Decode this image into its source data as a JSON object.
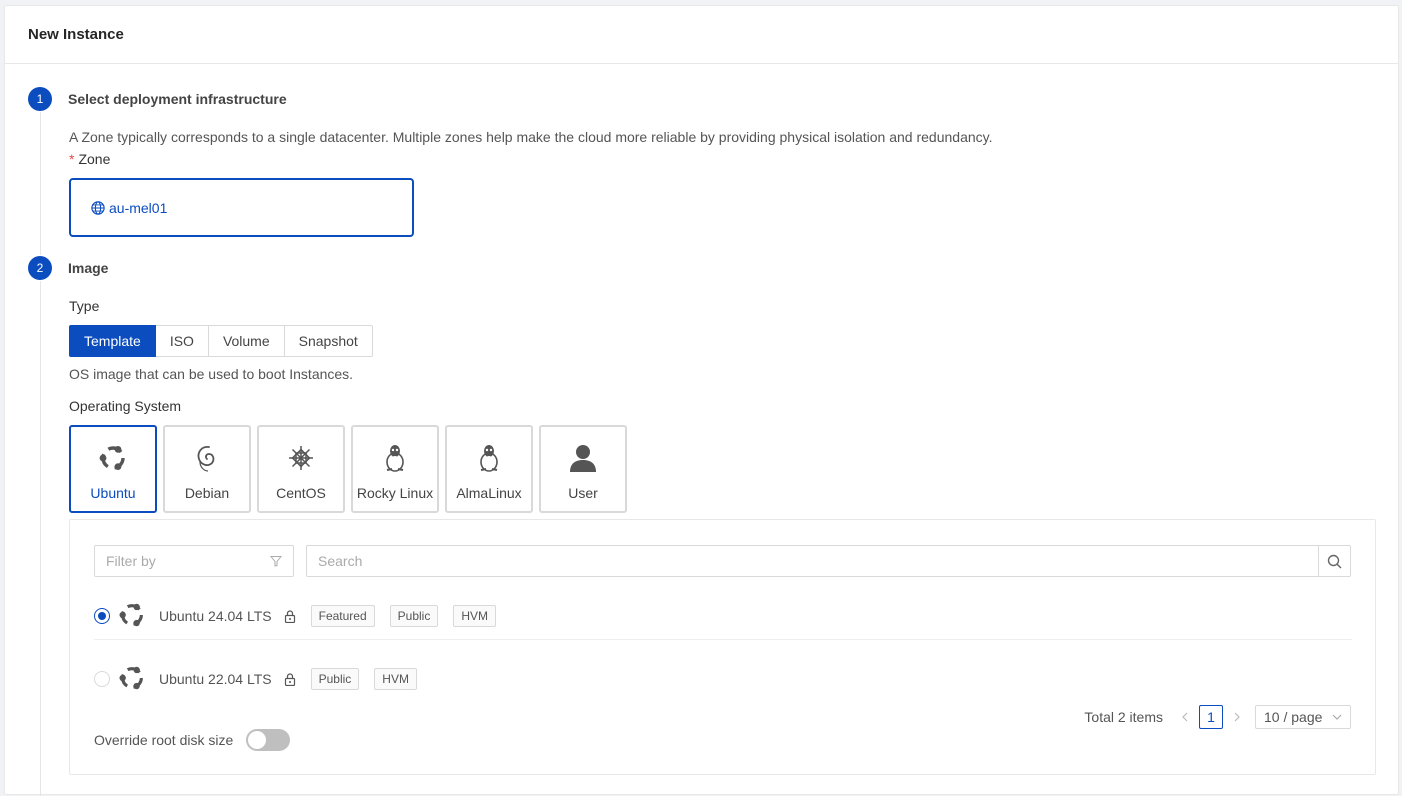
{
  "header": {
    "title": "New Instance"
  },
  "step1": {
    "number": "1",
    "title": "Select deployment infrastructure",
    "description": "A Zone typically corresponds to a single datacenter. Multiple zones help make the cloud more reliable by providing physical isolation and redundancy.",
    "zone_required_mark": "*",
    "zone_label": "Zone",
    "zone_value": "au-mel01",
    "zone_icon": "globe-icon"
  },
  "step2": {
    "number": "2",
    "title": "Image",
    "type_label": "Type",
    "types": [
      {
        "label": "Template",
        "active": true
      },
      {
        "label": "ISO",
        "active": false
      },
      {
        "label": "Volume",
        "active": false
      },
      {
        "label": "Snapshot",
        "active": false
      }
    ],
    "type_description": "OS image that can be used to boot Instances.",
    "os_label": "Operating System",
    "os_options": [
      {
        "label": "Ubuntu",
        "icon": "ubuntu-icon",
        "active": true
      },
      {
        "label": "Debian",
        "icon": "debian-icon",
        "active": false
      },
      {
        "label": "CentOS",
        "icon": "centos-icon",
        "active": false
      },
      {
        "label": "Rocky Linux",
        "icon": "linux-tux-icon",
        "active": false
      },
      {
        "label": "AlmaLinux",
        "icon": "linux-tux-icon",
        "active": false
      },
      {
        "label": "User",
        "icon": "user-icon",
        "active": false
      }
    ],
    "filter_placeholder": "Filter by",
    "search_placeholder": "Search",
    "images": [
      {
        "name": "Ubuntu 24.04 LTS",
        "selected": true,
        "tags": [
          "Featured",
          "Public",
          "HVM"
        ]
      },
      {
        "name": "Ubuntu 22.04 LTS",
        "selected": false,
        "tags": [
          "Public",
          "HVM"
        ]
      }
    ],
    "pagination": {
      "total_text": "Total 2 items",
      "current_page": "1",
      "page_size": "10 / page"
    },
    "override_label": "Override root disk size",
    "override_enabled": false
  },
  "colors": {
    "primary": "#0b4cbf",
    "required": "#e34a4a",
    "border": "#d9d9d9"
  }
}
